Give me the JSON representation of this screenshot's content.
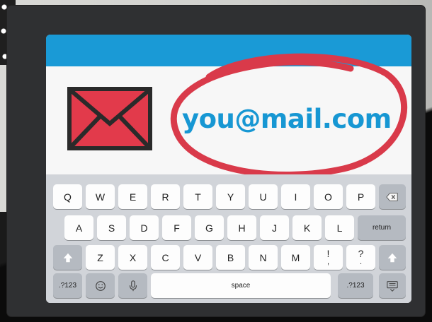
{
  "email": {
    "address": "you@mail.com"
  },
  "colors": {
    "accent_blue": "#1a9ad6",
    "envelope_red": "#e23a4b",
    "circle_red": "#d93a4a"
  },
  "keyboard": {
    "row1": [
      "Q",
      "W",
      "E",
      "R",
      "T",
      "Y",
      "U",
      "I",
      "O",
      "P"
    ],
    "row2": [
      "A",
      "S",
      "D",
      "F",
      "G",
      "H",
      "J",
      "K",
      "L"
    ],
    "row3": [
      "Z",
      "X",
      "C",
      "V",
      "B",
      "N",
      "M",
      "!",
      "?"
    ],
    "row3_subs": {
      "excl": ",",
      "ques": "."
    },
    "return_label": "return",
    "space_label": "space",
    "numbers_left": ".?123",
    "numbers_right": ".?123",
    "icons": {
      "backspace": "backspace-icon",
      "shift": "shift-icon",
      "emoji": "emoji-icon",
      "mic": "microphone-icon",
      "hide": "keyboard-hide-icon",
      "envelope": "envelope-icon"
    }
  }
}
